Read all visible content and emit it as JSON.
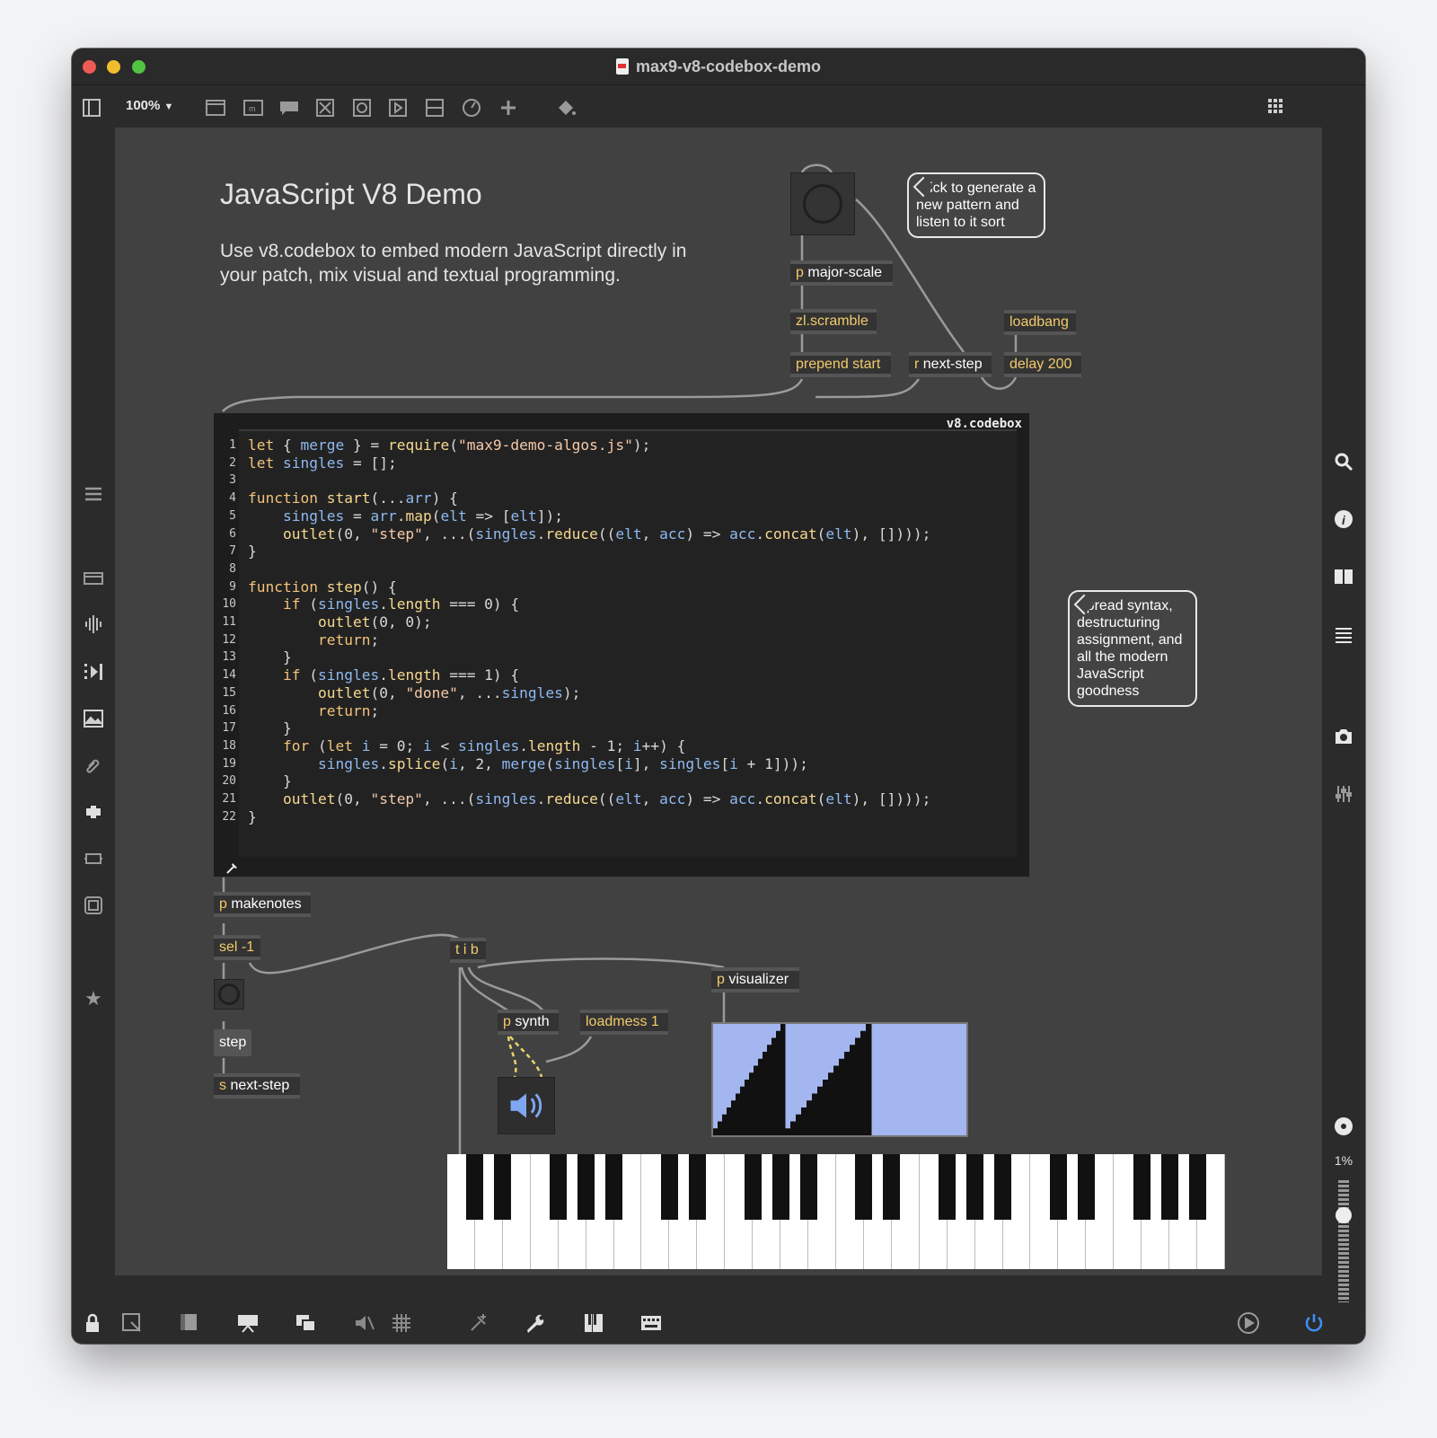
{
  "window": {
    "title": "max9-v8-codebox-demo",
    "traffic_lights": {
      "close": "#ee5b55",
      "minimize": "#f2bd2c",
      "zoom": "#52c342"
    }
  },
  "toolbar": {
    "zoom": "100%",
    "icons": [
      "sidebar-toggle-icon",
      "new-object-icon",
      "new-message-icon",
      "comment-icon",
      "toggle-icon",
      "button-icon",
      "slider-icon",
      "number-box-icon",
      "dial-icon",
      "add-icon",
      "paint-bucket-icon",
      "grid-display-icon"
    ]
  },
  "patch": {
    "title": "JavaScript V8 Demo",
    "description": "Use v8.codebox to embed modern JavaScript directly in your patch, mix visual and textual programming.",
    "comment_click": "Click to generate a new pattern and listen to it sort",
    "comment_spread": "Spread syntax, destructuring assignment, and all the modern JavaScript goodness",
    "objects": {
      "major_scale": {
        "prefix": "p",
        "name": "major-scale"
      },
      "zl_scramble": {
        "name": "zl.scramble"
      },
      "prepend_start": {
        "name": "prepend start"
      },
      "r_next_step": {
        "prefix": "r",
        "name": "next-step"
      },
      "loadbang": {
        "name": "loadbang"
      },
      "delay_200": {
        "name": "delay 200"
      },
      "p_makenotes": {
        "prefix": "p",
        "name": "makenotes"
      },
      "sel_minus1": {
        "name": "sel -1"
      },
      "tib": {
        "name": "t i b"
      },
      "p_visualizer": {
        "prefix": "p",
        "name": "visualizer"
      },
      "p_synth": {
        "prefix": "p",
        "name": "synth"
      },
      "loadmess_1": {
        "name": "loadmess 1"
      },
      "s_next_step": {
        "prefix": "s",
        "name": "next-step"
      }
    },
    "message_step": "step",
    "percent_readout": "1%"
  },
  "codebox": {
    "label": "v8.codebox",
    "lines": [
      "let { merge } = require(\"max9-demo-algos.js\");",
      "let singles = [];",
      "",
      "function start(...arr) {",
      "    singles = arr.map(elt => [elt]);",
      "    outlet(0, \"step\", ...(singles.reduce((elt, acc) => acc.concat(elt), [])));",
      "}",
      "",
      "function step() {",
      "    if (singles.length === 0) {",
      "        outlet(0, 0);",
      "        return;",
      "    }",
      "    if (singles.length === 1) {",
      "        outlet(0, \"done\", ...singles);",
      "        return;",
      "    }",
      "    for (let i = 0; i < singles.length - 1; i++) {",
      "        singles.splice(i, 2, merge(singles[i], singles[i + 1]));",
      "    }",
      "    outlet(0, \"step\", ...(singles.reduce((elt, acc) => acc.concat(elt), [])));",
      "}"
    ]
  },
  "visualizer": {
    "fill_color": "#a4b6ef",
    "bar_color": "#111111"
  },
  "colors": {
    "canvas": "#414141",
    "object_prefix": "#f2cb6b",
    "window": "#2b2b2b"
  }
}
